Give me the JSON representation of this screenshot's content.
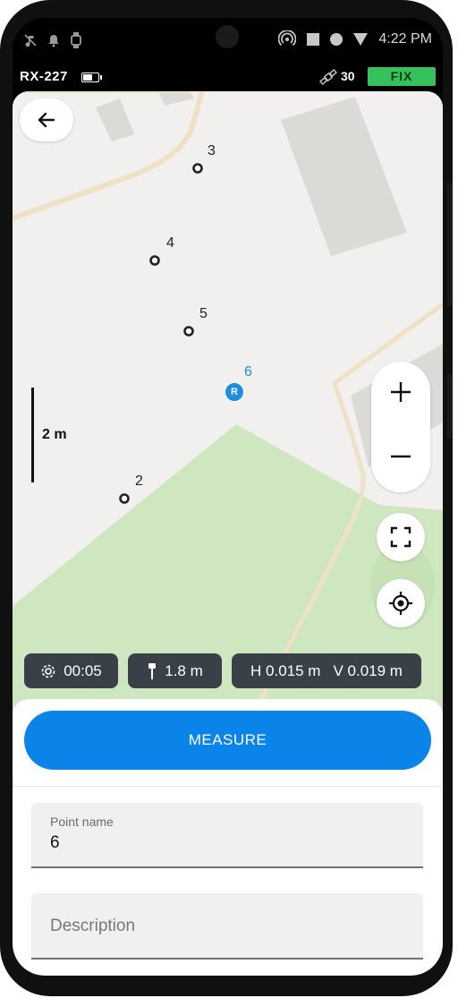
{
  "status_bar": {
    "time": "4:22 PM",
    "icons": [
      "music-off-icon",
      "bell-icon",
      "watch-icon",
      "hotspot-icon",
      "square-icon",
      "dot-icon",
      "wifi-triangle-icon"
    ]
  },
  "app_bar": {
    "device_name": "RX-227",
    "satellite_count": "30",
    "fix_status": "FIX",
    "fix_color": "#36c15d"
  },
  "map": {
    "points": [
      {
        "label": "3"
      },
      {
        "label": "4"
      },
      {
        "label": "5"
      },
      {
        "label": "6",
        "marker": "R"
      },
      {
        "label": "2"
      }
    ],
    "scale_label": "2 m"
  },
  "chips": {
    "timer": "00:05",
    "pole_height": "1.8 m",
    "h_precision": "H 0.015 m",
    "v_precision": "V 0.019 m"
  },
  "form": {
    "measure_label": "MEASURE",
    "point_name_label": "Point name",
    "point_name_value": "6",
    "description_placeholder": "Description"
  },
  "colors": {
    "accent": "#0a84e8",
    "chip_bg": "#3a4047",
    "park": "#cfe7c0"
  }
}
